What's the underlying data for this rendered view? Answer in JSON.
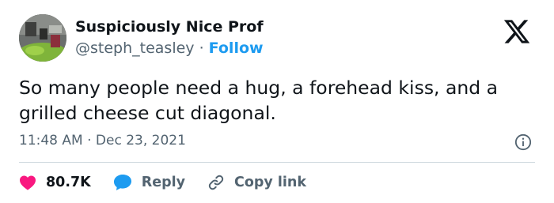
{
  "tweet": {
    "author": {
      "display_name": "Suspiciously Nice Prof",
      "handle": "@steph_teasley",
      "separator": " · ",
      "follow_label": "Follow"
    },
    "text": "So many people need a hug, a forehead kiss, and a grilled cheese cut diagonal.",
    "time": "11:48 AM",
    "date_separator": " · ",
    "date": "Dec 23, 2021",
    "actions": {
      "like_count": "80.7K",
      "reply_label": "Reply",
      "copy_label": "Copy link"
    }
  },
  "icons": {
    "brand": "x-logo-icon",
    "info": "info-icon",
    "like": "heart-icon",
    "reply": "speech-bubble-icon",
    "copy": "link-icon"
  },
  "colors": {
    "text": "#0f1419",
    "secondary": "#536471",
    "accent": "#1d9bf0",
    "like": "#f91880",
    "divider": "#cfd9de"
  }
}
